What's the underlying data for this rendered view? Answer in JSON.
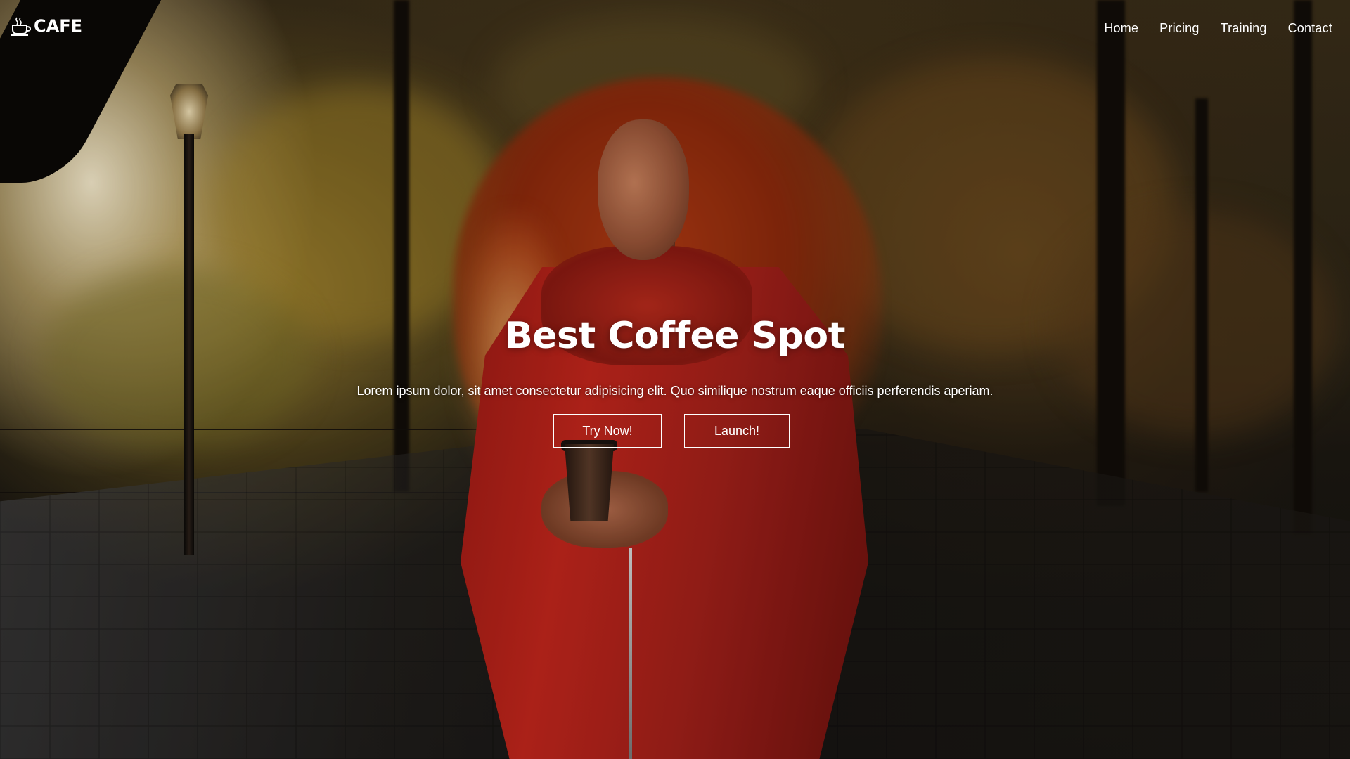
{
  "navbar": {
    "brand": "CAFE",
    "brand_icon": "coffee-cup-icon",
    "links": [
      "Home",
      "Pricing",
      "Training",
      "Contact"
    ]
  },
  "hero": {
    "title": "Best Coffee Spot",
    "subtitle": "Lorem ipsum dolor, sit amet consectetur adipisicing elit. Quo similique nostrum eaque officiis perferendis aperiam.",
    "buttons": {
      "primary": "Try Now!",
      "secondary": "Launch!"
    }
  },
  "colors": {
    "text": "#ffffff",
    "button_border": "#ffffff",
    "coat_red": "#c3261c"
  }
}
